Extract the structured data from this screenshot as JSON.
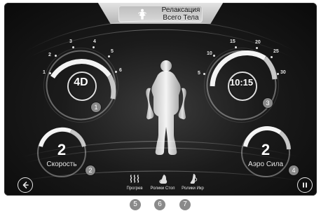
{
  "header": {
    "title_line1": "Релаксация",
    "title_line2": "Всего Тела"
  },
  "dials": {
    "program": {
      "value": "4D",
      "badge": "1",
      "ticks": [
        "1",
        "2",
        "3",
        "4",
        "5",
        "6"
      ]
    },
    "time": {
      "value": "10:15",
      "badge": "3",
      "ticks": [
        "5",
        "10",
        "15",
        "20",
        "25",
        "30"
      ]
    }
  },
  "controls": {
    "speed": {
      "value": "2",
      "label": "Скорость",
      "badge": "2"
    },
    "air_force": {
      "value": "2",
      "label": "Аэро Сила",
      "badge": "4"
    }
  },
  "functions": [
    {
      "label": "Прогрев",
      "icon": "heat-icon"
    },
    {
      "label": "Ролики Стоп",
      "icon": "foot-rollers-icon"
    },
    {
      "label": "Ролики Икр",
      "icon": "calf-rollers-icon"
    }
  ],
  "bottom_badges": [
    "5",
    "6",
    "7"
  ],
  "colors": {
    "badge": "#8a8a8a",
    "ring": "#e6e6e6",
    "background": "#0b0b0b"
  }
}
